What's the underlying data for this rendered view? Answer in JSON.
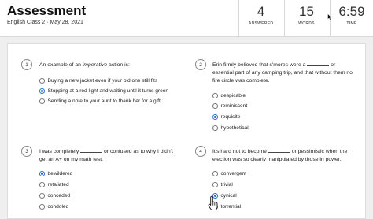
{
  "header": {
    "title": "Assessment",
    "subtitle": "English Class 2 · May 28, 2021",
    "stats": {
      "answered": {
        "value": "4",
        "label": "ANSWERED"
      },
      "words": {
        "value": "15",
        "label": "WORDS"
      },
      "time": {
        "value": "6:59",
        "label": "TIME"
      }
    }
  },
  "questions": [
    {
      "number": "1",
      "text_pre": "An example of an ",
      "text_em": "imperative",
      "text_post": " action is:",
      "options": [
        "Buying a new jacket even if your old one still fits",
        "Stopping at a red light and waiting until it turns green",
        "Sending a note to your aunt to thank her for a gift"
      ],
      "selected": 1
    },
    {
      "number": "2",
      "line1_pre": "Erin firmly believed that s'mores were a",
      "line1_post": "or",
      "line2": "essential part of any camping trip, and that without them no",
      "line3": "fire circle was complete.",
      "options": [
        "despicable",
        "reminiscent",
        "requisite",
        "hypothetical"
      ],
      "selected": 2
    },
    {
      "number": "3",
      "line1_pre": "I was completely",
      "line1_post": "or confused as to why I didn't",
      "line2": "get an A+ on my math test.",
      "options": [
        "bewildered",
        "retaliated",
        "conceded",
        "condoled"
      ],
      "selected": 0
    },
    {
      "number": "4",
      "line1_pre": "It's hard not to become",
      "line1_post": "or pessimistic when the",
      "line2": "election was so clearly manipulated by those in power.",
      "options": [
        "convergent",
        "trivial",
        "cynical",
        "torrential"
      ],
      "selected": 2
    }
  ],
  "colors": {
    "accent": "#2f6fd6",
    "background": "#efefef",
    "card": "#ffffff"
  }
}
